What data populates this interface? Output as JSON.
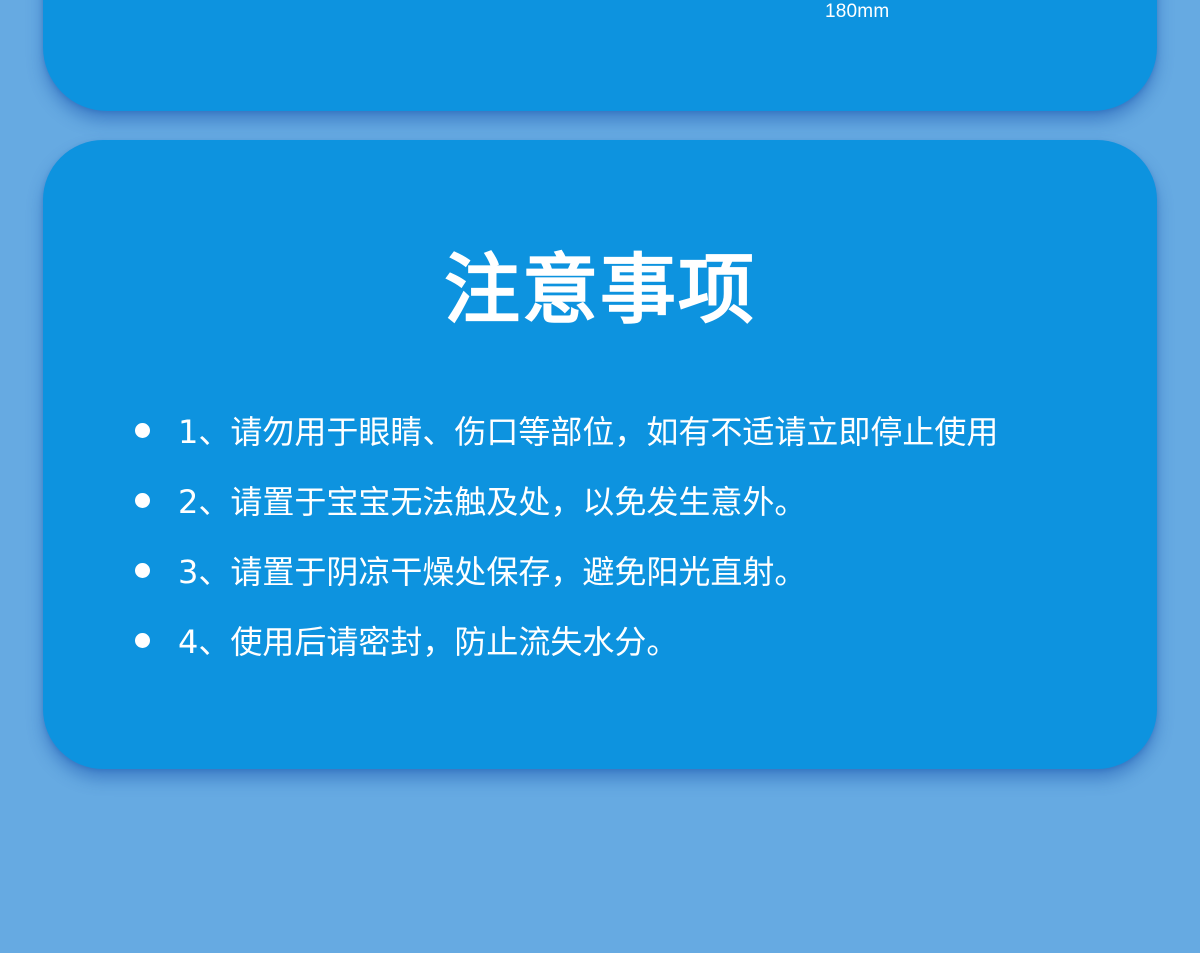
{
  "top_card": {
    "dimension_label": "180mm"
  },
  "notice": {
    "title": "注意事项",
    "items": [
      "1、请勿用于眼睛、伤口等部位，如有不适请立即停止使用",
      "2、请置于宝宝无法触及处，以免发生意外。",
      "3、请置于阴凉干燥处保存，避免阳光直射。",
      "4、使用后请密封，防止流失水分。"
    ]
  },
  "colors": {
    "page_background": "#66aae2",
    "card_background": "#0d93df",
    "text": "#ffffff"
  }
}
